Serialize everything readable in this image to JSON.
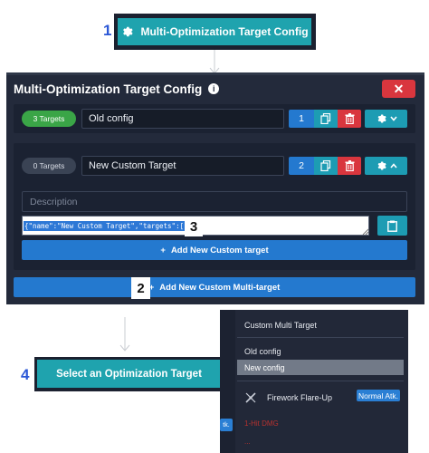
{
  "callouts": {
    "step1": "1",
    "step2": "2",
    "step3": "3",
    "step4": "4"
  },
  "top_button": {
    "label": "Multi-Optimization Target Config",
    "icon": "gear-icon"
  },
  "dialog": {
    "title": "Multi-Optimization Target Config",
    "info_icon": "i",
    "close_label": "✕",
    "rows": [
      {
        "badge": "3 Targets",
        "name": "Old config",
        "index": "1",
        "expanded": false
      },
      {
        "badge": "0 Targets",
        "name": "New Custom Target",
        "index": "2",
        "expanded": true,
        "description_placeholder": "Description",
        "json_value": "{\"name\":\"New Custom Target\",\"targets\":[]}",
        "add_target_label": "Add New Custom target"
      }
    ],
    "add_multi_label": "Add New Custom Multi-target"
  },
  "bottom_button": {
    "label": "Select an Optimization Target"
  },
  "dropdown": {
    "items": [
      {
        "label": "Custom Multi Target",
        "selected": false
      },
      {
        "label": "Old config",
        "selected": false
      },
      {
        "label": "New config",
        "selected": true
      }
    ],
    "target_name": "Firework Flare-Up",
    "target_badge": "Normal Atk.",
    "red_line_1": "1-Hit DMG",
    "red_line_2": "...",
    "left_badge": "tk."
  },
  "colors": {
    "teal": "#1fa3ae",
    "dialog_bg": "#232a3b",
    "blue": "#2479cf",
    "red": "#d9363e",
    "green": "#3aa547",
    "callout_blue": "#2b57d6"
  }
}
